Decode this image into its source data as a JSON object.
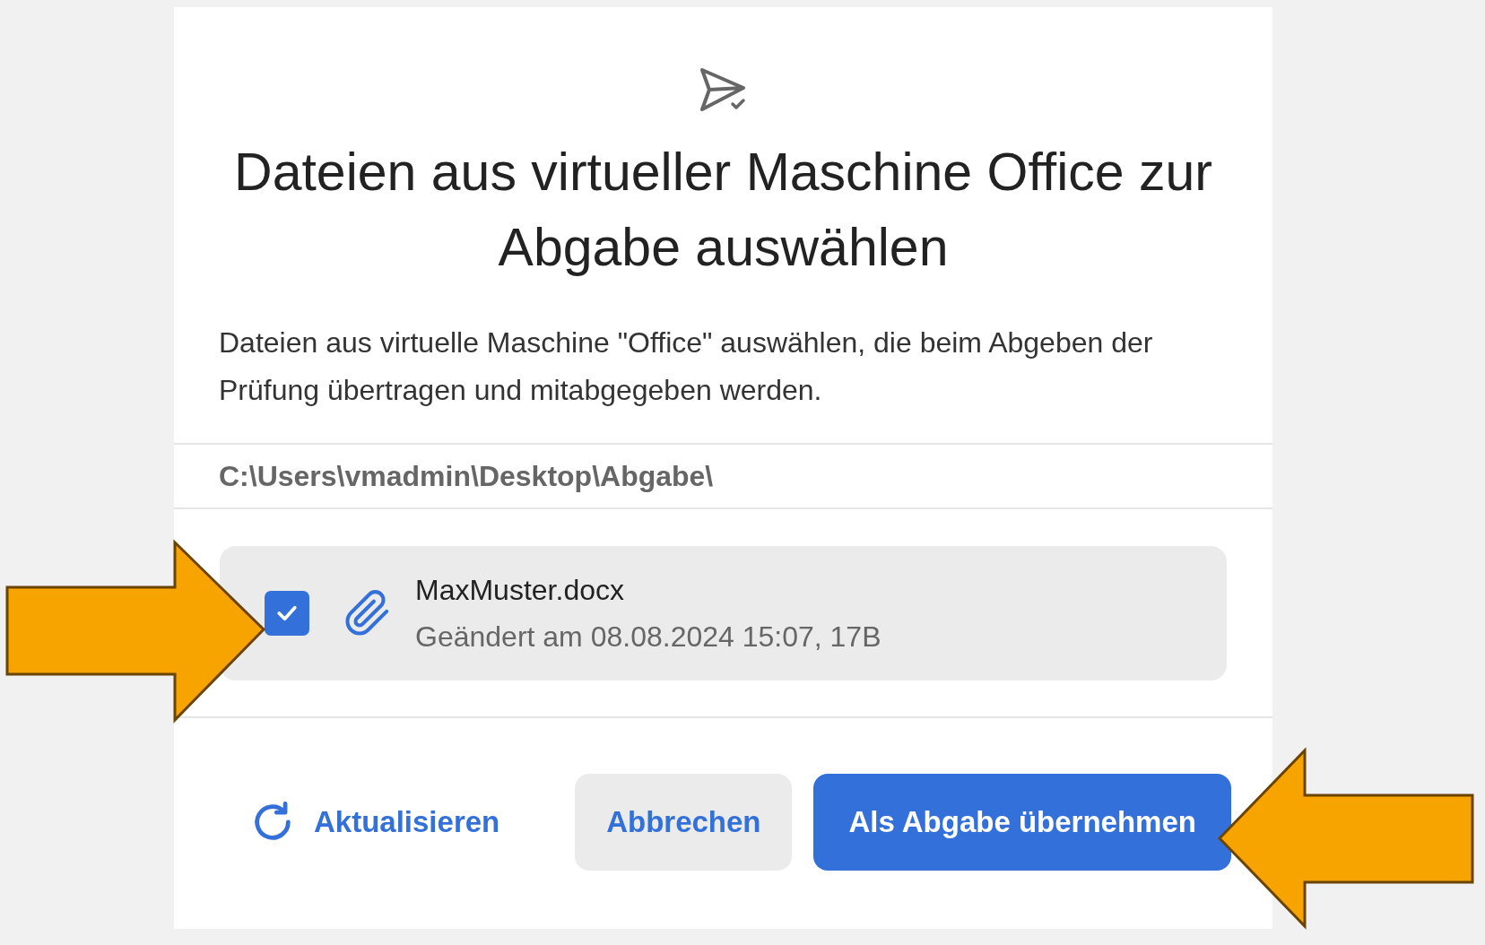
{
  "dialog": {
    "title": "Dateien aus virtueller Maschine Office zur Abgabe auswählen",
    "description": "Dateien aus virtuelle Maschine \"Office\" auswählen, die beim Abgeben der Prüfung übertragen und mitabgegeben werden.",
    "path": "C:\\Users\\vmadmin\\Desktop\\Abgabe\\",
    "files": [
      {
        "name": "MaxMuster.docx",
        "details": "Geändert am 08.08.2024 15:07, 17B",
        "checked": true
      }
    ],
    "buttons": [
      {
        "kind": "link",
        "label": "Aktualisieren"
      },
      {
        "kind": "secondary",
        "label": "Abbrechen"
      },
      {
        "kind": "primary",
        "label": "Als Abgabe übernehmen"
      }
    ]
  }
}
